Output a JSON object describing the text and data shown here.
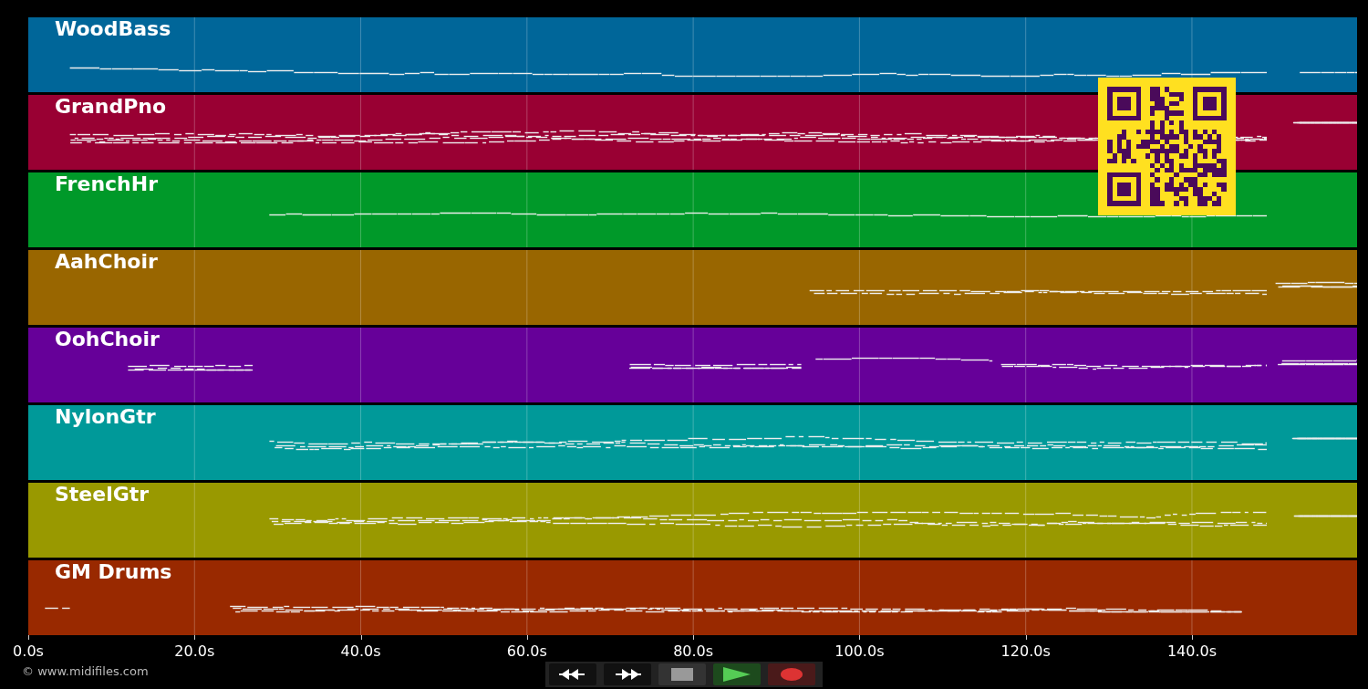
{
  "tracks": [
    {
      "name": "WoodBass",
      "color": "#006699"
    },
    {
      "name": "GrandPno",
      "color": "#990033"
    },
    {
      "name": "FrenchHr",
      "color": "#009929"
    },
    {
      "name": "AahChoir",
      "color": "#996600"
    },
    {
      "name": "OohChoir",
      "color": "#660099"
    },
    {
      "name": "NylonGtr",
      "color": "#009999"
    },
    {
      "name": "SteelGtr",
      "color": "#999900"
    },
    {
      "name": "GM Drums",
      "color": "#992900"
    }
  ],
  "time_axis": [
    "0.0s",
    "20.0s",
    "40.0s",
    "60.0s",
    "80.0s",
    "100.0s",
    "120.0s",
    "140.0s"
  ],
  "copyright": "© www.midifiles.com",
  "controls": [
    {
      "kind": "rewind"
    },
    {
      "kind": "fast-forward"
    },
    {
      "kind": "stop"
    },
    {
      "kind": "play"
    },
    {
      "kind": "record"
    }
  ]
}
